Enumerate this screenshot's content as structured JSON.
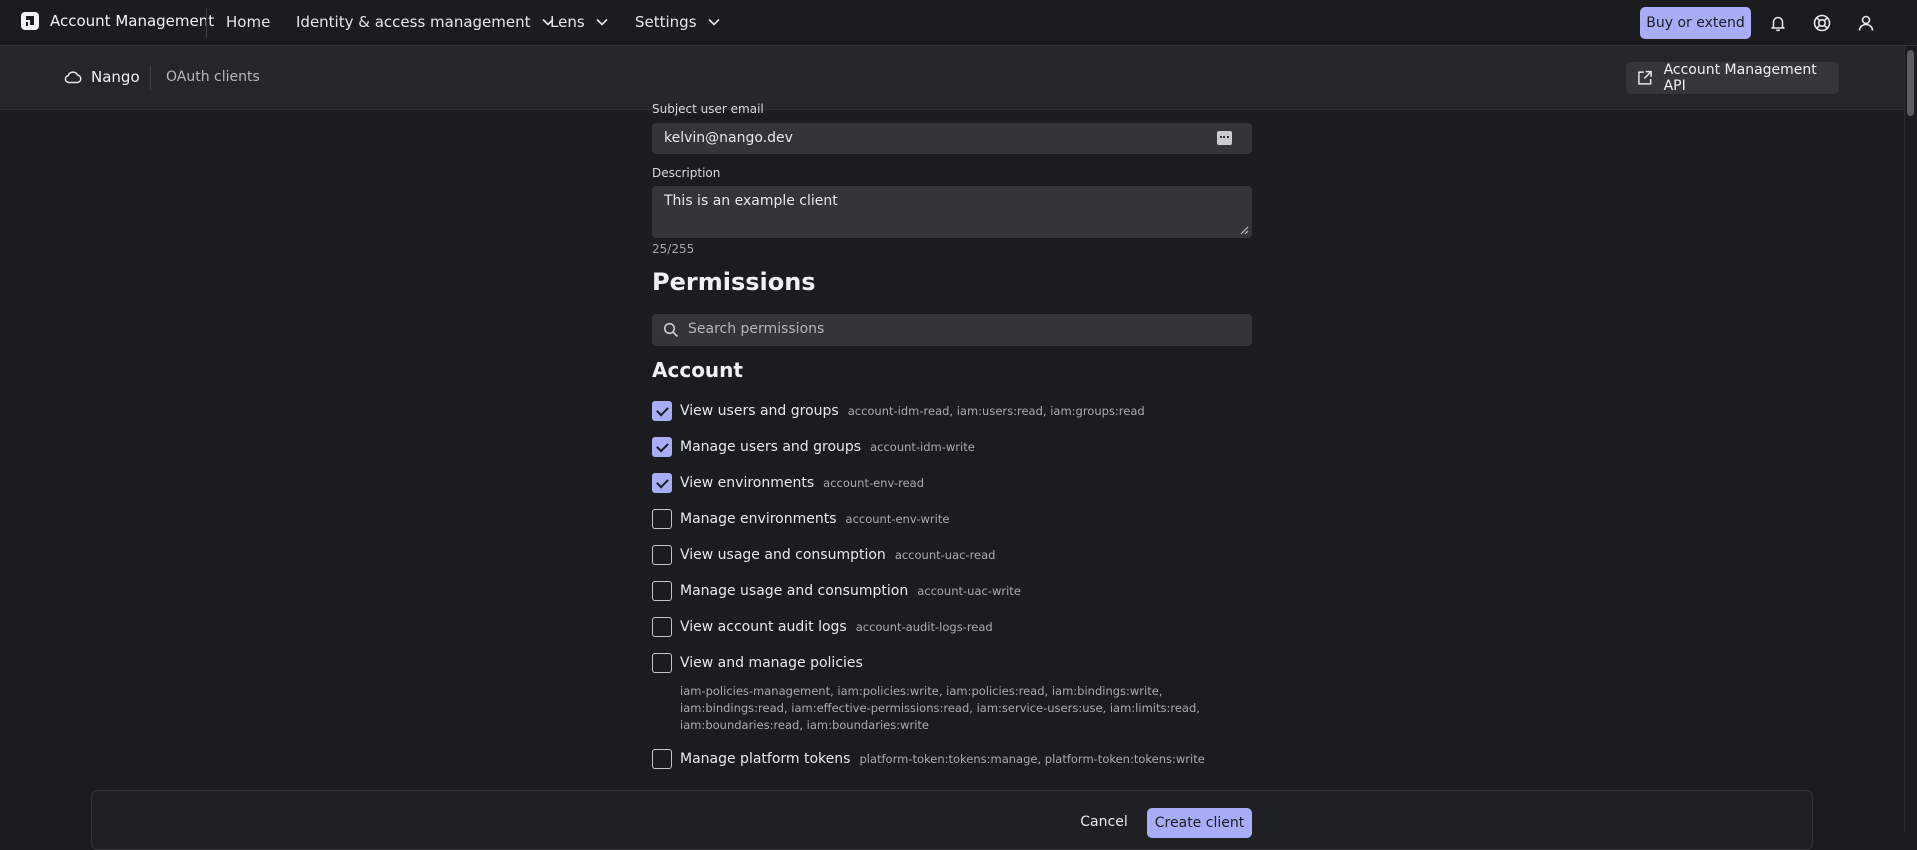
{
  "header": {
    "app_title": "Account Management",
    "nav": [
      {
        "label": "Home"
      },
      {
        "label": "Identity & access management"
      },
      {
        "label": "Lens"
      },
      {
        "label": "Settings"
      }
    ],
    "buy_button": "Buy or extend",
    "icons": [
      "bell-icon",
      "help-icon",
      "user-icon"
    ]
  },
  "subbar": {
    "org_name": "Nango",
    "current_page": "OAuth clients",
    "api_button": "Account Management API"
  },
  "form": {
    "subject_email_label": "Subject user email",
    "subject_email_value": "kelvin@nango.dev",
    "description_label": "Description",
    "description_value": "This is an example client",
    "char_counter": "25/255",
    "permissions_heading": "Permissions",
    "search_placeholder": "Search permissions",
    "account_heading": "Account",
    "permissions": [
      {
        "label": "View users and groups",
        "scope": "account-idm-read, iam:users:read, iam:groups:read",
        "checked": true
      },
      {
        "label": "Manage users and groups",
        "scope": "account-idm-write",
        "checked": true
      },
      {
        "label": "View environments",
        "scope": "account-env-read",
        "checked": true
      },
      {
        "label": "Manage environments",
        "scope": "account-env-write",
        "checked": false
      },
      {
        "label": "View usage and consumption",
        "scope": "account-uac-read",
        "checked": false
      },
      {
        "label": "Manage usage and consumption",
        "scope": "account-uac-write",
        "checked": false
      },
      {
        "label": "View account audit logs",
        "scope": "account-audit-logs-read",
        "checked": false
      },
      {
        "label": "View and manage policies",
        "scope": "iam-policies-management, iam:policies:write, iam:policies:read, iam:bindings:write, iam:bindings:read, iam:effective-permissions:read, iam:service-users:use, iam:limits:read, iam:boundaries:read, iam:boundaries:write",
        "checked": false
      },
      {
        "label": "Manage platform tokens",
        "scope": "platform-token:tokens:manage, platform-token:tokens:write",
        "checked": false
      }
    ]
  },
  "footer": {
    "cancel_label": "Cancel",
    "create_label": "Create client"
  },
  "colors": {
    "accent": "#a9adf7",
    "background": "#1b1c1f",
    "field": "#33353a"
  }
}
